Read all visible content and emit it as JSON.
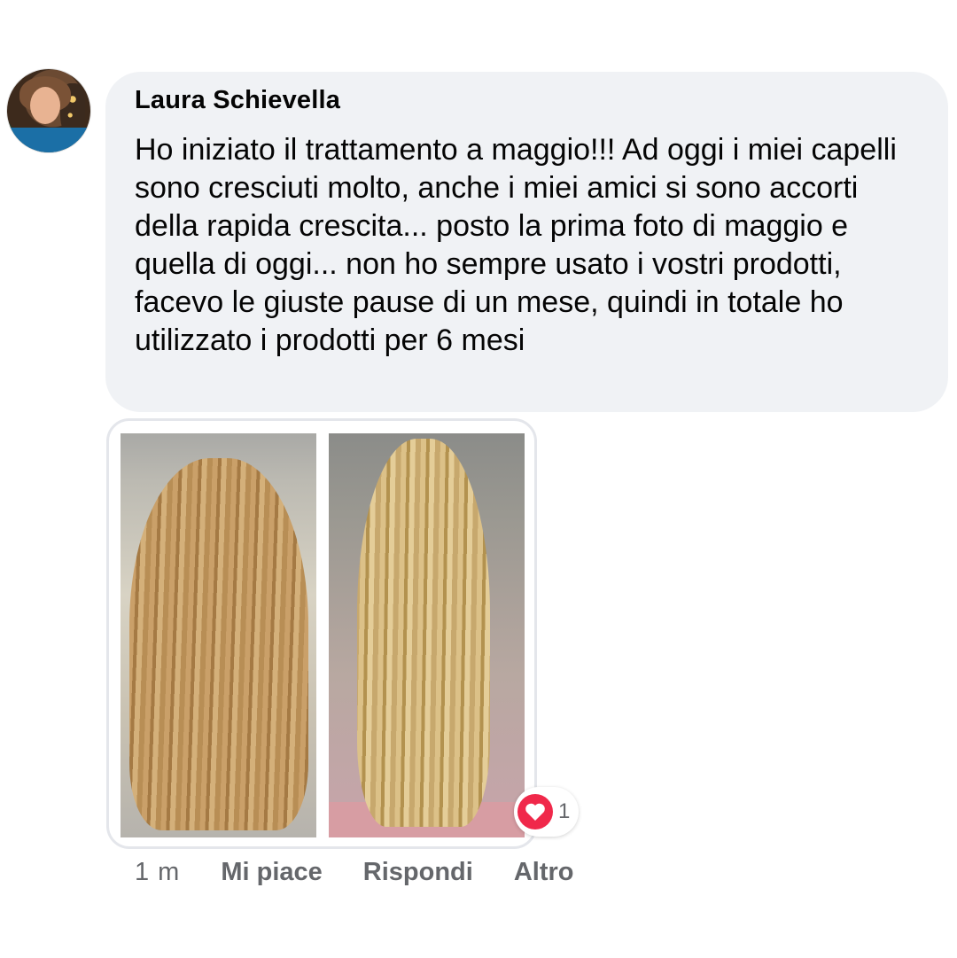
{
  "comment": {
    "author": "Laura Schievella",
    "text": "Ho iniziato il trattamento a maggio!!! Ad oggi i miei capelli sono cresciuti molto, anche i miei amici si sono accorti della rapida crescita... posto la prima foto di maggio e quella di oggi... non ho sempre usato i vostri prodotti, facevo le giuste pause di un mese, quindi in totale ho utilizzato i prodotti per 6 mesi"
  },
  "reactions": {
    "icon": "heart-icon",
    "count": "1",
    "color": "#f0284a"
  },
  "actions": {
    "time": "1 m",
    "like": "Mi piace",
    "reply": "Rispondi",
    "more": "Altro"
  },
  "colors": {
    "bubble": "#f0f2f5",
    "secondary_text": "#65676b",
    "primary_text": "#050505"
  }
}
